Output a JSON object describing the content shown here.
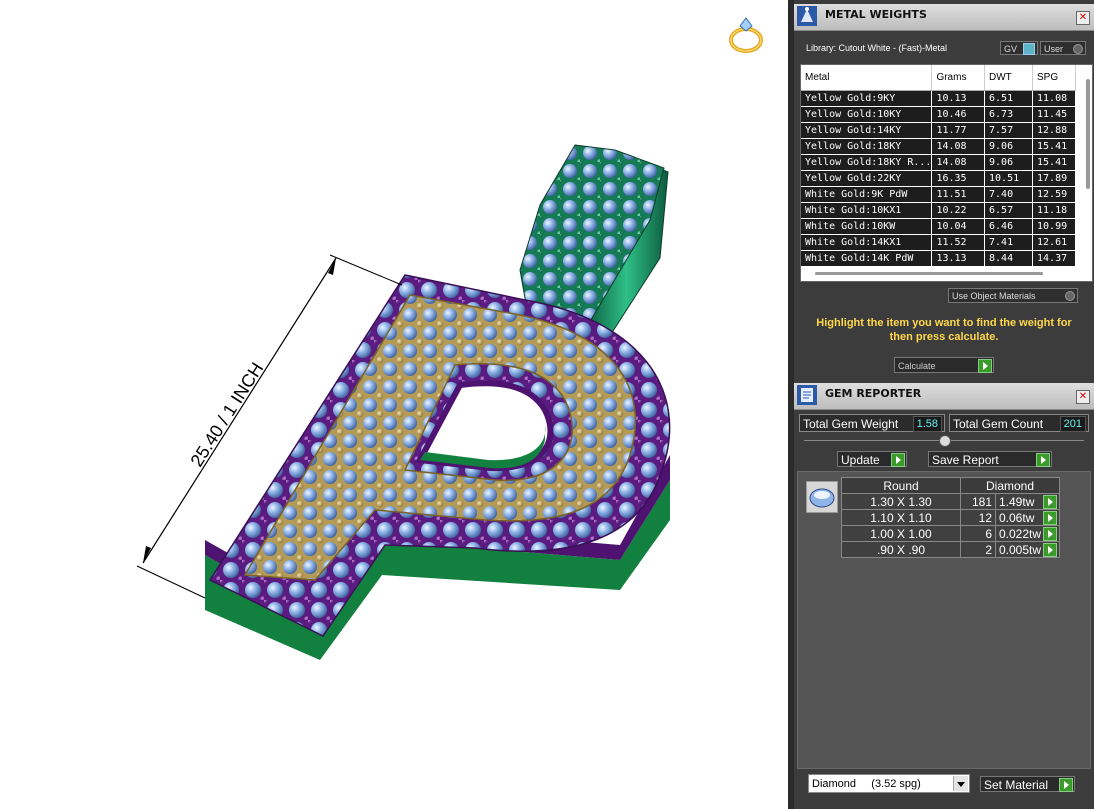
{
  "viewport": {
    "dimension_label": "25.40  / 1 INCH",
    "ring_icon": "ring-icon"
  },
  "metal_weights": {
    "title": "METAL WEIGHTS",
    "library_label": "Library: Cutout White - (Fast)-Metal",
    "gv_label": "GV",
    "user_label": "User",
    "columns": [
      "Metal",
      "Grams",
      "DWT",
      "SPG"
    ],
    "rows": [
      [
        "Yellow Gold:9KY",
        "10.13",
        "6.51",
        "11.08"
      ],
      [
        "Yellow Gold:10KY",
        "10.46",
        "6.73",
        "11.45"
      ],
      [
        "Yellow Gold:14KY",
        "11.77",
        "7.57",
        "12.88"
      ],
      [
        "Yellow Gold:18KY",
        "14.08",
        "9.06",
        "15.41"
      ],
      [
        "Yellow Gold:18KY R...",
        "14.08",
        "9.06",
        "15.41"
      ],
      [
        "Yellow Gold:22KY",
        "16.35",
        "10.51",
        "17.89"
      ],
      [
        "White Gold:9K PdW",
        "11.51",
        "7.40",
        "12.59"
      ],
      [
        "White Gold:10KX1",
        "10.22",
        "6.57",
        "11.18"
      ],
      [
        "White Gold:10KW",
        "10.04",
        "6.46",
        "10.99"
      ],
      [
        "White Gold:14KX1",
        "11.52",
        "7.41",
        "12.61"
      ],
      [
        "White Gold:14K PdW",
        "13.13",
        "8.44",
        "14.37"
      ]
    ],
    "use_object_materials": "Use Object Materials",
    "instruction": "Highlight the item you want to find the weight for then press calculate.",
    "calculate_label": "Calculate"
  },
  "gem_reporter": {
    "title": "GEM REPORTER",
    "total_weight_label": "Total Gem Weight",
    "total_weight_value": "1.58",
    "total_count_label": "Total Gem Count",
    "total_count_value": "201",
    "update_label": "Update",
    "save_report_label": "Save Report",
    "headers": [
      "Round",
      "Diamond"
    ],
    "rows": [
      [
        "1.30 X 1.30",
        "181",
        "1.49tw"
      ],
      [
        "1.10 X 1.10",
        "12",
        "0.06tw"
      ],
      [
        "1.00 X 1.00",
        "6",
        "0.022tw"
      ],
      [
        ".90 X .90",
        "2",
        "0.005tw"
      ]
    ],
    "material_select": "Diamond     (3.52 spg)",
    "set_material_label": "Set Material"
  },
  "colors": {
    "panel_bg": "#3c3c3c",
    "accent_yellow": "#ffd84a",
    "value_cyan": "#66eeee",
    "go_green": "#3a9b2a",
    "purple_metal": "#6a1f8f",
    "gold_metal": "#c8aa63",
    "green_metal": "#1b8a4e",
    "gem_blue": "#8fb4e8"
  }
}
